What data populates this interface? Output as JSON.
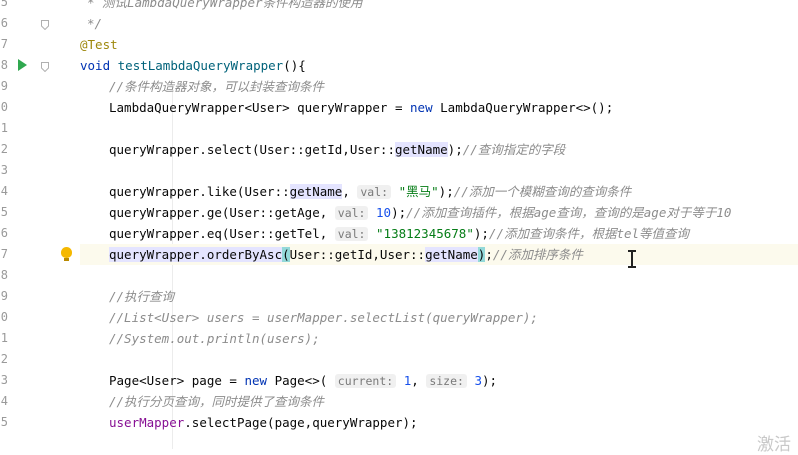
{
  "gutter": {
    "lines": [
      {
        "number": "5",
        "fold": false,
        "run": false,
        "bulb": false
      },
      {
        "number": "6",
        "fold": true,
        "run": false,
        "bulb": false
      },
      {
        "number": "7",
        "fold": false,
        "run": false,
        "bulb": false
      },
      {
        "number": "8",
        "fold": true,
        "run": true,
        "bulb": false
      },
      {
        "number": "9",
        "fold": false,
        "run": false,
        "bulb": false
      },
      {
        "number": "0",
        "fold": false,
        "run": false,
        "bulb": false
      },
      {
        "number": "1",
        "fold": false,
        "run": false,
        "bulb": false
      },
      {
        "number": "2",
        "fold": false,
        "run": false,
        "bulb": false
      },
      {
        "number": "3",
        "fold": false,
        "run": false,
        "bulb": false
      },
      {
        "number": "4",
        "fold": false,
        "run": false,
        "bulb": false
      },
      {
        "number": "5",
        "fold": false,
        "run": false,
        "bulb": false
      },
      {
        "number": "6",
        "fold": false,
        "run": false,
        "bulb": false
      },
      {
        "number": "7",
        "fold": false,
        "run": false,
        "bulb": true
      },
      {
        "number": "8",
        "fold": false,
        "run": false,
        "bulb": false
      },
      {
        "number": "9",
        "fold": false,
        "run": false,
        "bulb": false
      },
      {
        "number": "0",
        "fold": false,
        "run": false,
        "bulb": false
      },
      {
        "number": "1",
        "fold": false,
        "run": false,
        "bulb": false
      },
      {
        "number": "2",
        "fold": false,
        "run": false,
        "bulb": false
      },
      {
        "number": "3",
        "fold": false,
        "run": false,
        "bulb": false
      },
      {
        "number": "4",
        "fold": false,
        "run": false,
        "bulb": false
      },
      {
        "number": "5",
        "fold": false,
        "run": false,
        "bulb": false
      }
    ]
  },
  "editor": {
    "current_line_index": 12,
    "lines": [
      {
        "indent": "   ",
        "tokens": [
          {
            "t": "* 测试LambdaQueryWrapper条件构造器的使用",
            "c": "doc"
          }
        ]
      },
      {
        "indent": "   ",
        "tokens": [
          {
            "t": "*/",
            "c": "doc"
          }
        ]
      },
      {
        "indent": "",
        "tokens": [
          {
            "t": "@Test",
            "c": "ann"
          }
        ]
      },
      {
        "indent": "",
        "tokens": [
          {
            "t": "void ",
            "c": "kw"
          },
          {
            "t": "testLambdaQueryWrapper",
            "c": "method"
          },
          {
            "t": "(){",
            "c": "plain"
          }
        ]
      },
      {
        "indent": "    ",
        "tokens": [
          {
            "t": "//条件构造器对象，可以封装查询条件",
            "c": "cmt"
          }
        ]
      },
      {
        "indent": "    ",
        "tokens": [
          {
            "t": "LambdaQueryWrapper<User> queryWrapper = ",
            "c": "plain"
          },
          {
            "t": "new ",
            "c": "kw"
          },
          {
            "t": "LambdaQueryWrapper<>();",
            "c": "plain"
          }
        ]
      },
      {
        "indent": "",
        "tokens": []
      },
      {
        "indent": "    ",
        "tokens": [
          {
            "t": "queryWrapper.select(User::getId,User::",
            "c": "plain"
          },
          {
            "t": "getName",
            "c": "hl"
          },
          {
            "t": ");",
            "c": "plain"
          },
          {
            "t": "//查询指定的字段",
            "c": "cmt"
          }
        ]
      },
      {
        "indent": "",
        "tokens": []
      },
      {
        "indent": "    ",
        "tokens": [
          {
            "t": "queryWrapper.like(User::",
            "c": "plain"
          },
          {
            "t": "getName",
            "c": "hl"
          },
          {
            "t": ", ",
            "c": "plain"
          },
          {
            "t": "val:",
            "c": "hint"
          },
          {
            "t": " ",
            "c": "plain"
          },
          {
            "t": "\"黑马\"",
            "c": "str"
          },
          {
            "t": ");",
            "c": "plain"
          },
          {
            "t": "//添加一个模糊查询的查询条件",
            "c": "cmt"
          }
        ]
      },
      {
        "indent": "    ",
        "tokens": [
          {
            "t": "queryWrapper.ge(User::getAge, ",
            "c": "plain"
          },
          {
            "t": "val:",
            "c": "hint"
          },
          {
            "t": " ",
            "c": "plain"
          },
          {
            "t": "10",
            "c": "num"
          },
          {
            "t": ");",
            "c": "plain"
          },
          {
            "t": "//添加查询插件，根据age查询，查询的是age对于等于10",
            "c": "cmt"
          }
        ]
      },
      {
        "indent": "    ",
        "tokens": [
          {
            "t": "queryWrapper.eq(User::getTel, ",
            "c": "plain"
          },
          {
            "t": "val:",
            "c": "hint"
          },
          {
            "t": " ",
            "c": "plain"
          },
          {
            "t": "\"13812345678\"",
            "c": "str"
          },
          {
            "t": ");",
            "c": "plain"
          },
          {
            "t": "//添加查询条件，根据tel等值查询",
            "c": "cmt"
          }
        ]
      },
      {
        "indent": "    ",
        "tokens": [
          {
            "t": "queryWrapper.orderByAsc",
            "c": "hlbox"
          },
          {
            "t": "(",
            "c": "brace"
          },
          {
            "t": "User::getId,User::",
            "c": "plain"
          },
          {
            "t": "getName",
            "c": "hl"
          },
          {
            "t": ")",
            "c": "brace"
          },
          {
            "t": ";",
            "c": "plain"
          },
          {
            "t": "//添加排序条件",
            "c": "cmt"
          }
        ]
      },
      {
        "indent": "",
        "tokens": []
      },
      {
        "indent": "    ",
        "tokens": [
          {
            "t": "//执行查询",
            "c": "cmt"
          }
        ]
      },
      {
        "indent": "    ",
        "tokens": [
          {
            "t": "//List<User> users = userMapper.selectList(queryWrapper);",
            "c": "cmt"
          }
        ]
      },
      {
        "indent": "    ",
        "tokens": [
          {
            "t": "//System.out.println(users);",
            "c": "cmt"
          }
        ]
      },
      {
        "indent": "",
        "tokens": []
      },
      {
        "indent": "    ",
        "tokens": [
          {
            "t": "Page<User> page = ",
            "c": "plain"
          },
          {
            "t": "new ",
            "c": "kw"
          },
          {
            "t": "Page<>( ",
            "c": "plain"
          },
          {
            "t": "current:",
            "c": "hint"
          },
          {
            "t": " ",
            "c": "plain"
          },
          {
            "t": "1",
            "c": "num"
          },
          {
            "t": ", ",
            "c": "plain"
          },
          {
            "t": "size:",
            "c": "hint"
          },
          {
            "t": " ",
            "c": "plain"
          },
          {
            "t": "3",
            "c": "num"
          },
          {
            "t": ");",
            "c": "plain"
          }
        ]
      },
      {
        "indent": "    ",
        "tokens": [
          {
            "t": "//执行分页查询，同时提供了查询条件",
            "c": "cmt"
          }
        ]
      },
      {
        "indent": "    ",
        "tokens": [
          {
            "t": "userMapper",
            "c": "field"
          },
          {
            "t": ".selectPage(page,queryWrapper);",
            "c": "plain"
          }
        ]
      }
    ]
  },
  "watermark": "激活"
}
